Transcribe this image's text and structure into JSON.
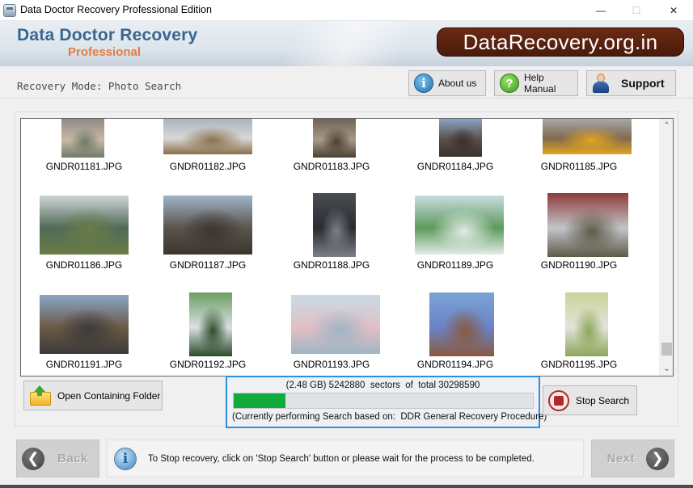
{
  "window": {
    "title": "Data Doctor Recovery Professional Edition",
    "controls": {
      "minimize": "—",
      "maximize": "☐",
      "close": "✕"
    }
  },
  "banner": {
    "brand_main": "Data Doctor Recovery",
    "brand_sub": "Professional",
    "site": "DataRecovery.org.in",
    "colors": {
      "brand_main": "#38668f",
      "brand_sub": "#e87c3e",
      "site_bg": "#5a2210"
    }
  },
  "mode": {
    "label": "Recovery Mode: Photo Search"
  },
  "top_buttons": {
    "about": {
      "label": "About us",
      "icon": "info-icon"
    },
    "help": {
      "label": "Help Manual",
      "icon": "question-icon"
    },
    "support": {
      "label": "Support",
      "icon": "support-person-icon"
    }
  },
  "gallery": {
    "items": [
      {
        "name": "GNDR01181.JPG",
        "colors": [
          "#8f8b86",
          "#c9b8a4",
          "#6f7a68"
        ]
      },
      {
        "name": "GNDR01182.JPG",
        "colors": [
          "#aab4bf",
          "#d8d8d6",
          "#8a6f4a"
        ]
      },
      {
        "name": "GNDR01183.JPG",
        "colors": [
          "#6e6456",
          "#a89a88",
          "#4a3f33"
        ]
      },
      {
        "name": "GNDR01184.JPG",
        "colors": [
          "#8aa2c4",
          "#5b4e48",
          "#3a302c"
        ]
      },
      {
        "name": "GNDR01185.JPG",
        "colors": [
          "#a8a8a8",
          "#7f6a4e",
          "#e2a521"
        ]
      },
      {
        "name": "GNDR01186.JPG",
        "colors": [
          "#cfd5d6",
          "#4f6b57",
          "#6a7c46"
        ]
      },
      {
        "name": "GNDR01187.JPG",
        "colors": [
          "#9fb4c8",
          "#5a544c",
          "#3c352e"
        ]
      },
      {
        "name": "GNDR01188.JPG",
        "colors": [
          "#4a4d52",
          "#2a2c30",
          "#7b8088"
        ]
      },
      {
        "name": "GNDR01189.JPG",
        "colors": [
          "#c9dde3",
          "#5c9a5a",
          "#e3ece8"
        ]
      },
      {
        "name": "GNDR01190.JPG",
        "colors": [
          "#8e3a3a",
          "#c2c6ca",
          "#5e5a48"
        ]
      },
      {
        "name": "GNDR01191.JPG",
        "colors": [
          "#8aa6c9",
          "#6b5a44",
          "#3c3a3a"
        ]
      },
      {
        "name": "GNDR01192.JPG",
        "colors": [
          "#6c9e62",
          "#d9e1e2",
          "#2d4a2a"
        ]
      },
      {
        "name": "GNDR01193.JPG",
        "colors": [
          "#c8dbe6",
          "#e3bfc5",
          "#9fb5c3"
        ]
      },
      {
        "name": "GNDR01194.JPG",
        "colors": [
          "#7ba4d4",
          "#6a83c8",
          "#8a5a3e"
        ]
      },
      {
        "name": "GNDR01195.JPG",
        "colors": [
          "#c9d39a",
          "#e2e3da",
          "#8ea65a"
        ]
      }
    ],
    "scroll": {
      "up": "⌃",
      "down": "⌄"
    }
  },
  "controls": {
    "open_folder": "Open Containing Folder",
    "stop_search": "Stop Search"
  },
  "progress": {
    "line1": "(2.48 GB) 5242880  sectors  of  total 30298590",
    "sectors_done": 5242880,
    "sectors_total": 30298590,
    "size_done": "2.48 GB",
    "fraction": 0.173,
    "line2": "(Currently performing Search based on:  DDR General Recovery Procedure)",
    "fill_color": "#11aa3c"
  },
  "footer": {
    "back": "Back",
    "next": "Next",
    "info": "To Stop recovery, click on 'Stop Search' button or please wait for the process to be completed."
  }
}
